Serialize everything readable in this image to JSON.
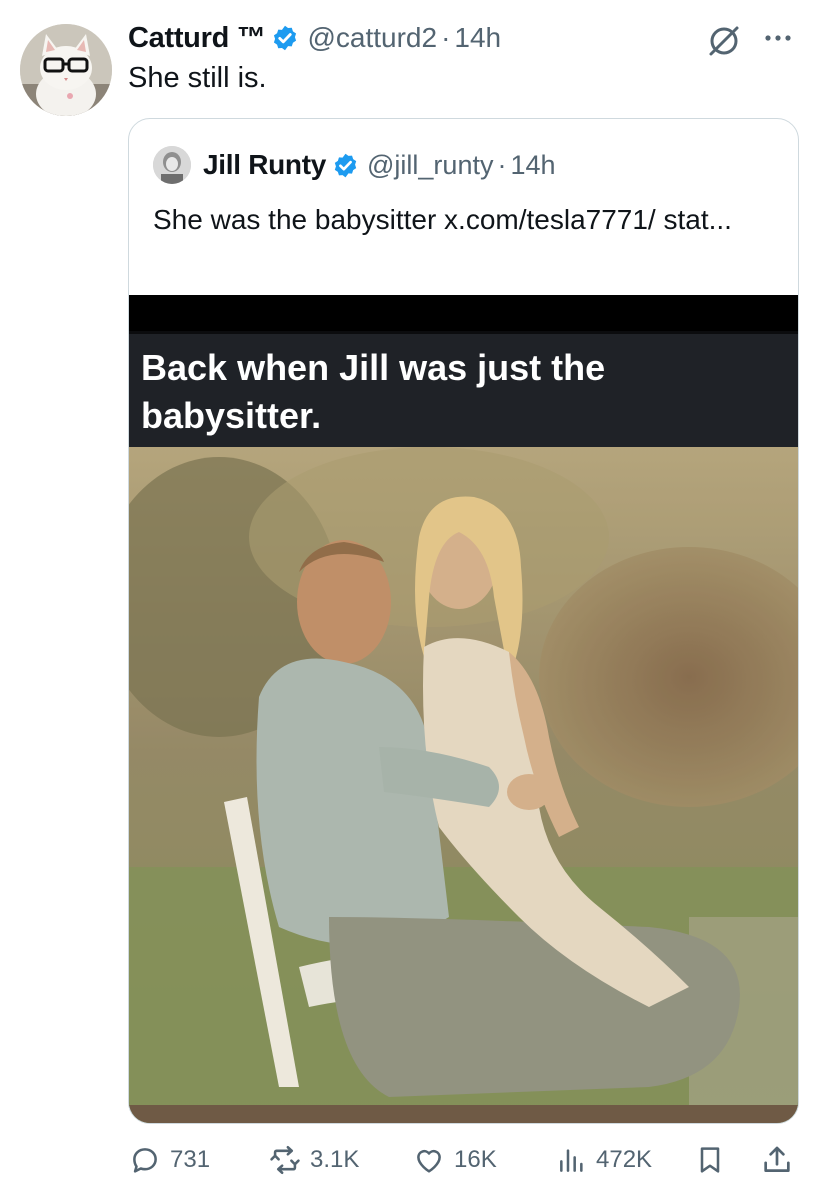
{
  "tweet": {
    "author_name": "Catturd ™",
    "handle": "@catturd2",
    "separator": "·",
    "time": "14h",
    "text": "She still is."
  },
  "quoted": {
    "author_name": "Jill Runty",
    "handle": "@jill_runty",
    "separator": "·",
    "time": "14h",
    "text": "She was the babysitter x.com/tesla7771/ stat...",
    "media_caption": "Back when Jill was just the babysitter."
  },
  "stats": {
    "replies": "731",
    "reposts": "3.1K",
    "likes": "16K",
    "views": "472K"
  },
  "icons": {
    "verified": "verified-badge-icon",
    "grok": "grok-icon",
    "more": "more-icon",
    "reply": "reply-icon",
    "repost": "repost-icon",
    "like": "like-icon",
    "views": "views-icon",
    "bookmark": "bookmark-icon",
    "share": "share-icon"
  },
  "colors": {
    "verified": "#1d9bf0",
    "secondary_text": "#536471",
    "primary_text": "#0f1419"
  }
}
